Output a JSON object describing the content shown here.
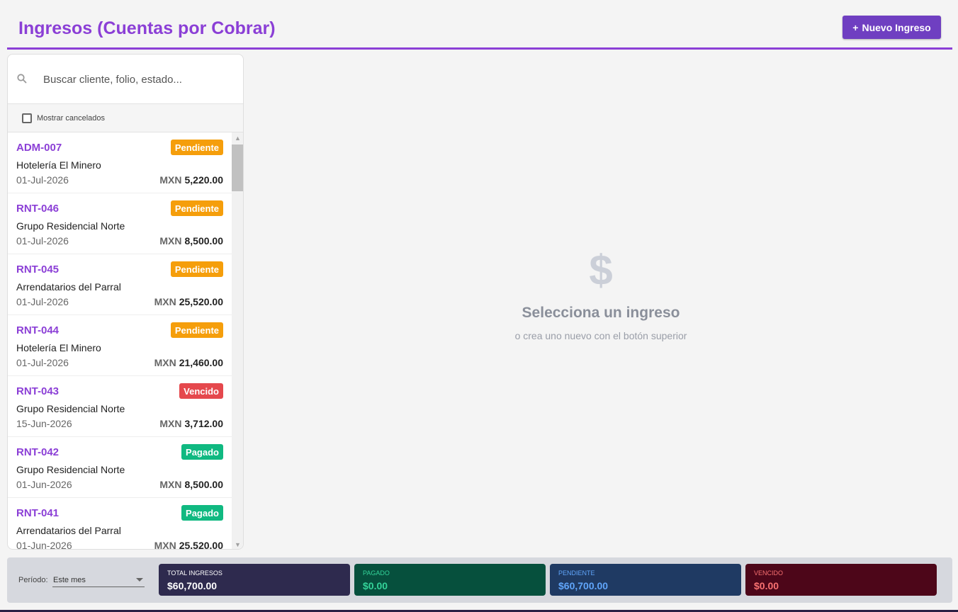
{
  "header": {
    "title": "Ingresos (Cuentas por Cobrar)",
    "new_button": {
      "icon": "+",
      "label": "Nuevo Ingreso"
    }
  },
  "sidebar": {
    "search_placeholder": "Buscar cliente, folio, estado...",
    "show_cancelled_label": "Mostrar cancelados",
    "show_cancelled_checked": false,
    "items": [
      {
        "folio": "ADM-007",
        "status": "Pendiente",
        "status_color": "#f59e0b",
        "client": "Hotelería El Minero",
        "date": "01-Jul-2026",
        "currency": "MXN",
        "amount": "5,220.00"
      },
      {
        "folio": "RNT-046",
        "status": "Pendiente",
        "status_color": "#f59e0b",
        "client": "Grupo Residencial Norte",
        "date": "01-Jul-2026",
        "currency": "MXN",
        "amount": "8,500.00"
      },
      {
        "folio": "RNT-045",
        "status": "Pendiente",
        "status_color": "#f59e0b",
        "client": "Arrendatarios del Parral",
        "date": "01-Jul-2026",
        "currency": "MXN",
        "amount": "25,520.00"
      },
      {
        "folio": "RNT-044",
        "status": "Pendiente",
        "status_color": "#f59e0b",
        "client": "Hotelería El Minero",
        "date": "01-Jul-2026",
        "currency": "MXN",
        "amount": "21,460.00"
      },
      {
        "folio": "RNT-043",
        "status": "Vencido",
        "status_color": "#e5484d",
        "client": "Grupo Residencial Norte",
        "date": "15-Jun-2026",
        "currency": "MXN",
        "amount": "3,712.00"
      },
      {
        "folio": "RNT-042",
        "status": "Pagado",
        "status_color": "#10b981",
        "client": "Grupo Residencial Norte",
        "date": "01-Jun-2026",
        "currency": "MXN",
        "amount": "8,500.00"
      },
      {
        "folio": "RNT-041",
        "status": "Pagado",
        "status_color": "#10b981",
        "client": "Arrendatarios del Parral",
        "date": "01-Jun-2026",
        "currency": "MXN",
        "amount": "25,520.00"
      }
    ]
  },
  "empty_state": {
    "icon": "dollar-icon",
    "symbol": "$",
    "title": "Selecciona un ingreso",
    "subtitle": "o crea uno nuevo con el botón superior"
  },
  "footer": {
    "period_label": "Período:",
    "period_value": "Este mes",
    "stats": [
      {
        "label": "TOTAL INGRESOS",
        "value": "$60,700.00",
        "bg": "#2e2a4e",
        "label_color": "#ffffff",
        "value_color": "#ffffff"
      },
      {
        "label": "PAGADO",
        "value": "$0.00",
        "bg": "#06503d",
        "label_color": "#34d399",
        "value_color": "#34d399"
      },
      {
        "label": "PENDIENTE",
        "value": "$60,700.00",
        "bg": "#1f3a63",
        "label_color": "#60a5fa",
        "value_color": "#60a5fa"
      },
      {
        "label": "VENCIDO",
        "value": "$0.00",
        "bg": "#4d0619",
        "label_color": "#f87171",
        "value_color": "#f87171"
      }
    ]
  },
  "colors": {
    "accent": "#8b3fd6",
    "button": "#6f3fc1"
  }
}
